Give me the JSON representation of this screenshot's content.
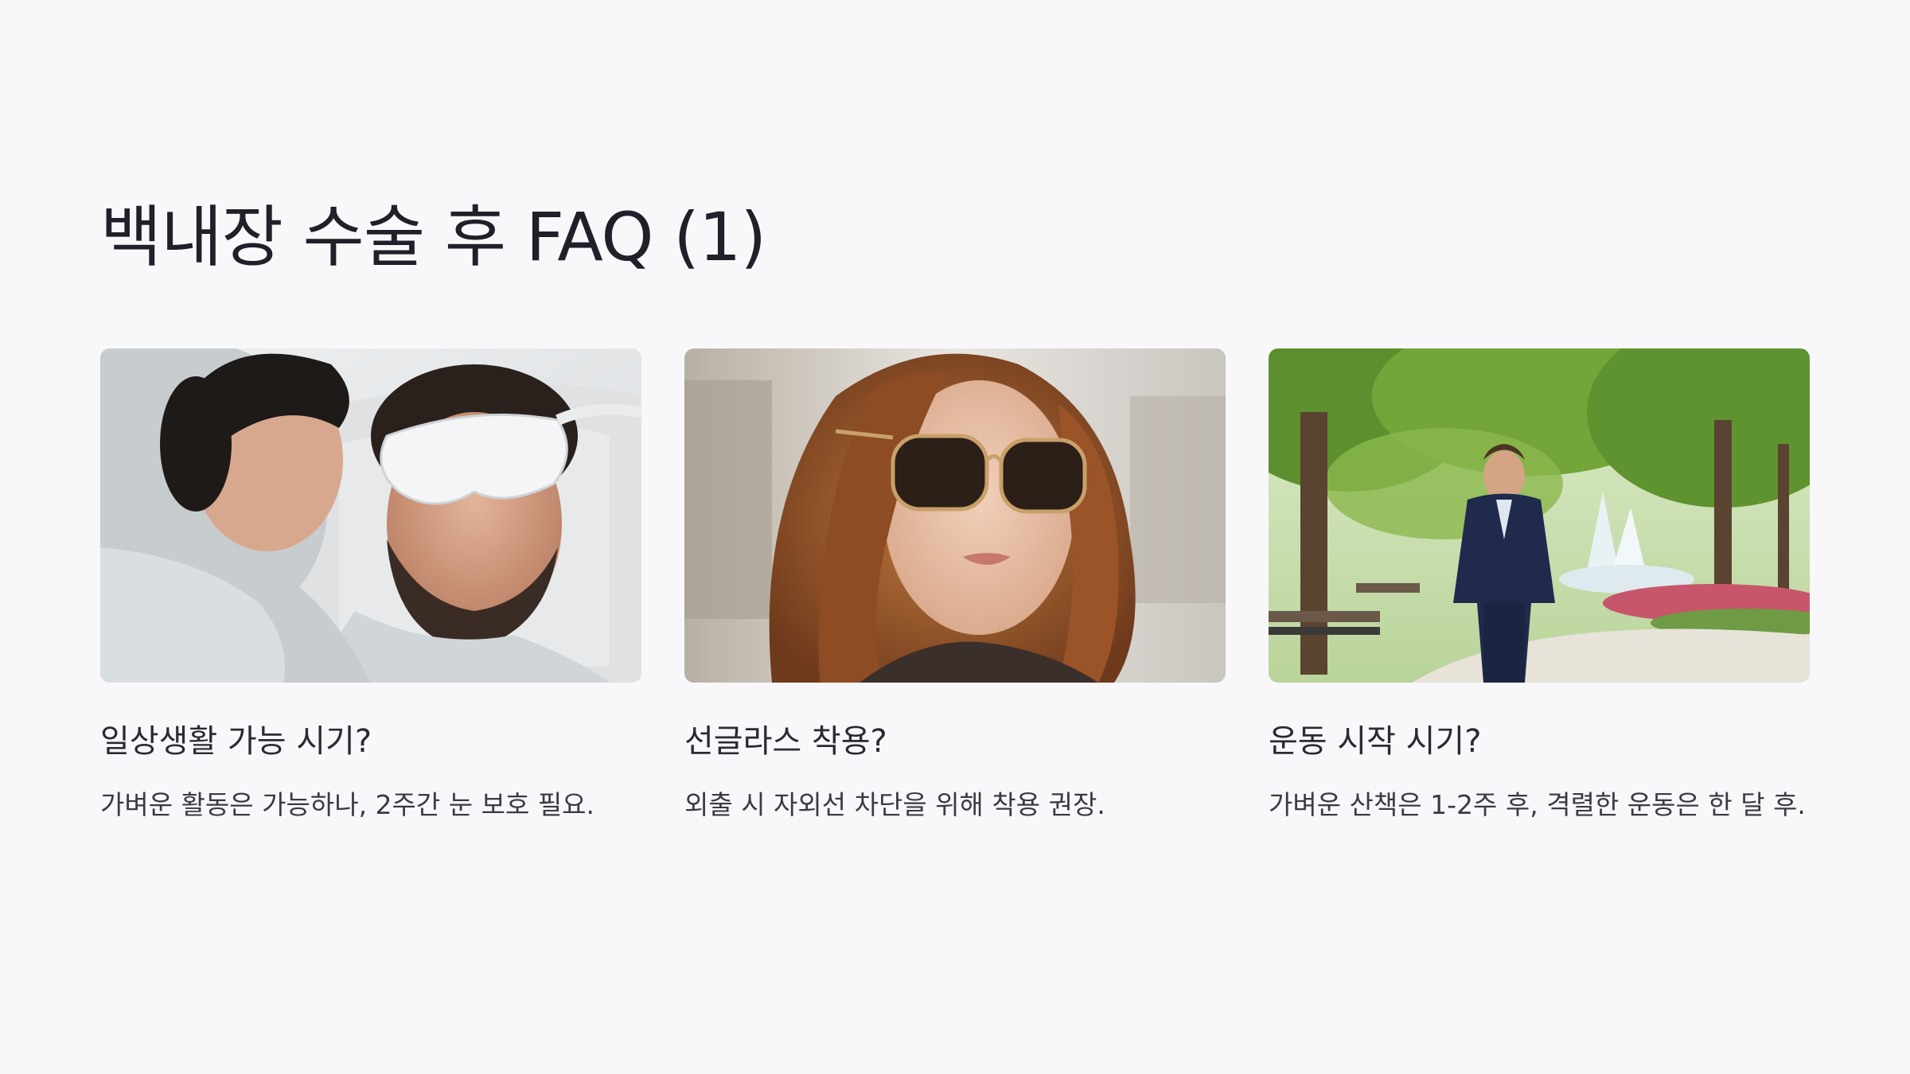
{
  "slide": {
    "title": "백내장 수술 후 FAQ (1)"
  },
  "cards": [
    {
      "image_description": "photo-recovering-patient",
      "question": "일상생활 가능 시기?",
      "answer": "가벼운 활동은 가능하나, 2주간 눈 보호 필요."
    },
    {
      "image_description": "photo-woman-sunglasses",
      "question": "선글라스 착용?",
      "answer": "외출 시 자외선 차단을 위해 착용 권장."
    },
    {
      "image_description": "photo-man-walking-park",
      "question": "운동 시작 시기?",
      "answer": "가벼운 산책은 1-2주 후, 격렬한 운동은 한 달 후."
    }
  ],
  "colors": {
    "background": "#f8f8fb",
    "title": "#20202a",
    "text": "#3a3a44"
  }
}
